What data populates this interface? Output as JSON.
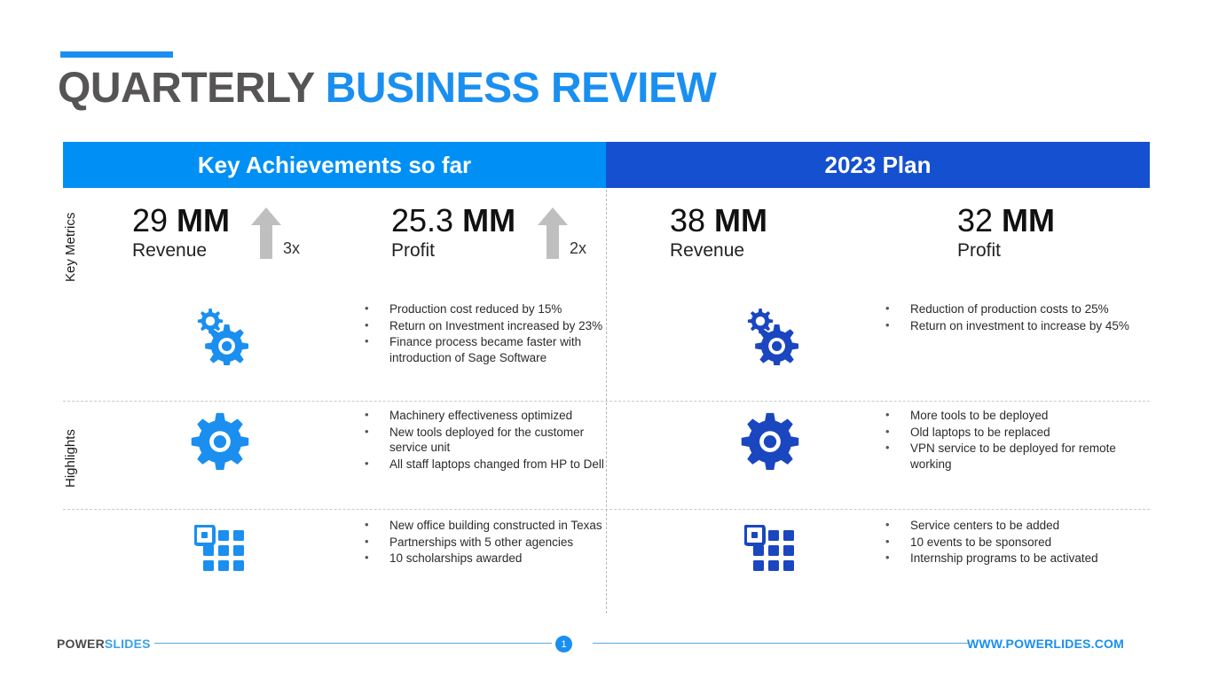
{
  "title": {
    "part1": "QUARTERLY ",
    "part2": "BUSINESS REVIEW"
  },
  "columns": {
    "left_header": "Key Achievements so far",
    "right_header": "2023 Plan"
  },
  "side_labels": {
    "metrics": "Key Metrics",
    "highlights": "Highlights"
  },
  "metrics": [
    {
      "number": "29",
      "unit": " MM",
      "label": "Revenue",
      "multiplier": "3x",
      "side": "left"
    },
    {
      "number": "25.3",
      "unit": " MM",
      "label": "Profit",
      "multiplier": "2x",
      "side": "left"
    },
    {
      "number": "38",
      "unit": " MM",
      "label": "Revenue",
      "multiplier": "",
      "side": "right"
    },
    {
      "number": "32",
      "unit": " MM",
      "label": "Profit",
      "multiplier": "",
      "side": "right"
    }
  ],
  "rows": [
    {
      "icon": "gears-icon",
      "left_bullets": [
        "Production cost reduced by 15%",
        "Return on Investment increased by 23%",
        "Finance process became faster with introduction of Sage Software"
      ],
      "right_bullets": [
        "Reduction of production costs to 25%",
        "Return on investment to increase by 45%"
      ]
    },
    {
      "icon": "gear-icon",
      "left_bullets": [
        "Machinery effectiveness optimized",
        "New tools deployed for the customer service unit",
        "All staff laptops changed from HP to Dell"
      ],
      "right_bullets": [
        "More tools to be deployed",
        "Old laptops to be replaced",
        "VPN service to be deployed for remote working"
      ]
    },
    {
      "icon": "grid-icon",
      "left_bullets": [
        "New office building constructed in Texas",
        "Partnerships with 5 other agencies",
        "10 scholarships awarded"
      ],
      "right_bullets": [
        "Service centers to be added",
        "10 events to be sponsored",
        "Internship programs to be activated"
      ]
    }
  ],
  "footer": {
    "brand_part1": "POWER",
    "brand_part2": "SLIDES",
    "page_number": "1",
    "url": "WWW.POWERLIDES.COM"
  },
  "colors": {
    "accent_light_blue": "#0090f5",
    "accent_dark_blue": "#1550d0",
    "title_gray": "#565454",
    "title_blue": "#1a8ff0",
    "arrow_gray": "#bfbfbf"
  }
}
